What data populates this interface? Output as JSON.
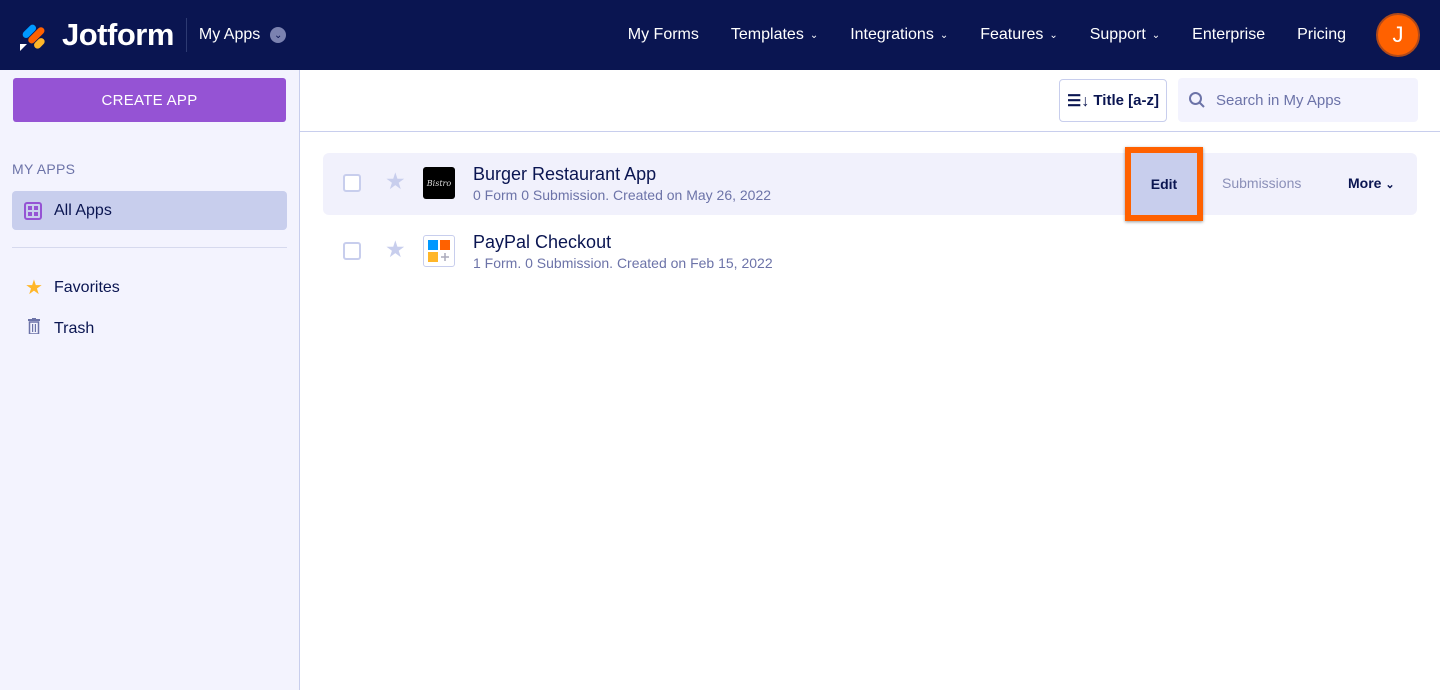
{
  "header": {
    "brand": "Jotform",
    "section": "My Apps",
    "nav": [
      "My Forms",
      "Templates",
      "Integrations",
      "Features",
      "Support",
      "Enterprise",
      "Pricing"
    ],
    "nav_dropdown": [
      false,
      true,
      true,
      true,
      true,
      false,
      false
    ],
    "avatar_initial": "J"
  },
  "sidebar": {
    "create_label": "CREATE APP",
    "title": "MY APPS",
    "all_apps": "All Apps",
    "favorites": "Favorites",
    "trash": "Trash"
  },
  "toolbar": {
    "sort_label": "Title [a-z]",
    "search_placeholder": "Search in My Apps"
  },
  "apps": [
    {
      "name": "Burger Restaurant App",
      "meta": "0 Form 0 Submission. Created on May 26, 2022"
    },
    {
      "name": "PayPal Checkout",
      "meta": "1 Form. 0 Submission. Created on Feb 15, 2022"
    }
  ],
  "row_actions": {
    "edit": "Edit",
    "submissions": "Submissions",
    "more": "More"
  },
  "colors": {
    "nav_bg": "#0a1551",
    "accent": "#9553d4",
    "highlight": "#ff6100"
  }
}
